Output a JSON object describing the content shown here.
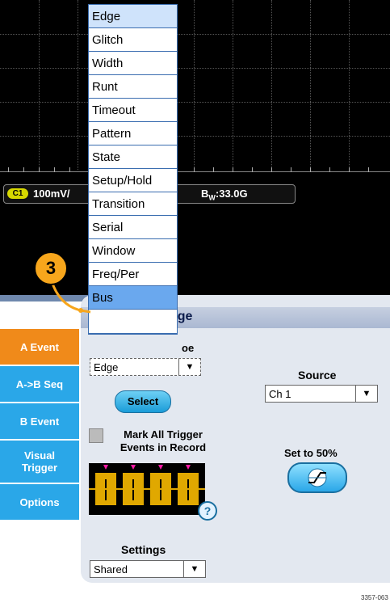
{
  "status_bar": {
    "channel_badge": "C1",
    "scale": "100mV/",
    "bandwidth": "B",
    "bandwidth_sub": "W",
    "bandwidth_value": ":33.0G"
  },
  "trigger_menu": {
    "items": [
      "Edge",
      "Glitch",
      "Width",
      "Runt",
      "Timeout",
      "Pattern",
      "State",
      "Setup/Hold",
      "Transition",
      "Serial",
      "Window",
      "Freq/Per",
      "Bus",
      ""
    ],
    "selected": "Edge",
    "highlighted": "Bus"
  },
  "callout": {
    "number": "3"
  },
  "panel": {
    "title": "dge",
    "tabs": [
      "A Event",
      "A->B Seq",
      "B Event",
      "Visual Trigger",
      "Options"
    ],
    "active_tab": "A Event",
    "type_label": "oe",
    "type_value": "Edge",
    "select_button": "Select",
    "source_label": "Source",
    "source_value": "Ch 1",
    "mark_all_label": "Mark All Trigger Events in Record",
    "set_to_50_label": "Set to 50%",
    "help_icon": "?",
    "settings_label": "Settings",
    "settings_value": "Shared"
  },
  "figure_id": "3357-063",
  "colors": {
    "accent_tab": "#2aa7e8",
    "active_tab": "#f08a1a",
    "channel": "#d7d800",
    "callout": "#f7a61c",
    "highlight": "#6aa8ee"
  }
}
